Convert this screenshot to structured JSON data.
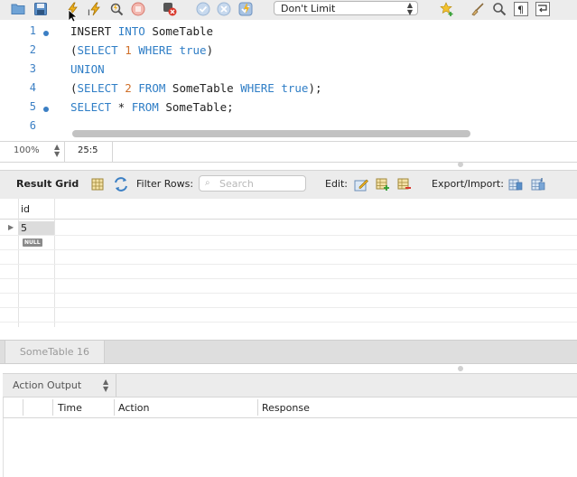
{
  "toolbar": {
    "limit_select": "Don't Limit",
    "icons": [
      "open-file-icon",
      "save-icon",
      "execute-icon",
      "execute-current-icon",
      "explain-icon",
      "stop-icon",
      "stop-on-error-icon",
      "commit-icon",
      "rollback-icon",
      "autocommit-icon",
      "bookmark-icon",
      "beautify-icon",
      "find-icon",
      "invisible-chars-icon",
      "wrap-icon"
    ]
  },
  "editor": {
    "lines": [
      {
        "number": "1"
      },
      {
        "number": "2"
      },
      {
        "number": "3"
      },
      {
        "number": "4"
      },
      {
        "number": "5"
      },
      {
        "number": "6"
      }
    ]
  },
  "statusbar": {
    "zoom": "100%",
    "cursor_position": "25:5"
  },
  "result_toolbar": {
    "title": "Result Grid",
    "filter_label": "Filter Rows:",
    "search_placeholder": "Search",
    "edit_label": "Edit:",
    "export_label": "Export/Import:"
  },
  "grid": {
    "columns": [
      "id"
    ],
    "rows": [
      {
        "id": "5"
      },
      {
        "id": "NULL"
      }
    ]
  },
  "tabs": {
    "result_tab": "SomeTable 16"
  },
  "action_output": {
    "title": "Action Output",
    "columns": [
      "Time",
      "Action",
      "Response"
    ]
  }
}
